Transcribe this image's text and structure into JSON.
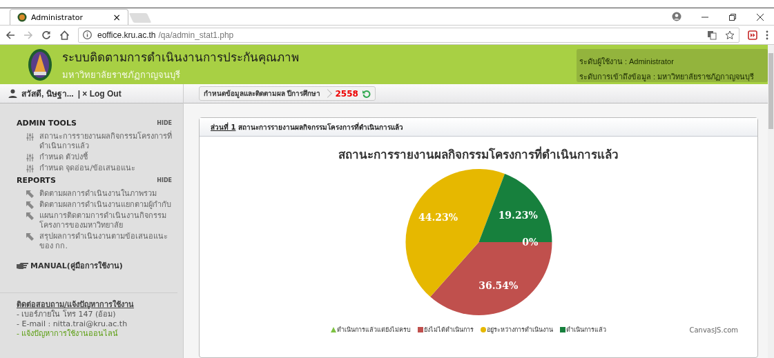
{
  "browser": {
    "tab_title": "Administrator",
    "tab_close": "×",
    "url_host": "eoffice.kru.ac.th",
    "url_path": "/qa/admin_stat1.php"
  },
  "header": {
    "title": "ระบบติดตามการดำเนินงานการประกันคุณภาพ",
    "subtitle": "มหาวิทยาลัยราชภัฏกาญจนบุรี",
    "user_level": "ระดับผู้ใช้งาน : Administrator",
    "access_level": "ระดับการเข้าถึงข้อมูล : มหาวิทยาลัยราชภัฏกาญจนบุรี"
  },
  "user_bar": {
    "greeting": "สวัสดี, นิษฐา...",
    "logout": "| × Log Out"
  },
  "breadcrumb": {
    "label": "กำหนดข้อมูลและติดตามผล ปีการศึกษา",
    "year": "2558"
  },
  "sidebar": {
    "sections": [
      {
        "title": "ADMIN TOOLS",
        "hide": "HIDE",
        "kind": "tools",
        "items": [
          "สถานะการรายงานผลกิจกรรมโครงการที่ดำเนินการแล้ว",
          "กำหนด ตัวบ่งชี้",
          "กำหนด จุดอ่อน/ข้อเสนอแนะ"
        ]
      },
      {
        "title": "REPORTS",
        "hide": "HIDE",
        "kind": "reports",
        "items": [
          "ติดตามผลการดำเนินงานในภาพรวม",
          "ติดตามผลการดำเนินงานแยกตามผู้กำกับ",
          "แผนการติดตามการดำเนินงานกิจกรรมโครงการของมหาวิทยาลัย",
          "สรุปผลการดำเนินงานตามข้อเสนอแนะของ กก."
        ]
      }
    ],
    "manual": "MANUAL(คู่มือการใช้งาน)",
    "contact": {
      "title": "ติดต่อสอบถาม/แจ้งปัญหาการใช้งาน",
      "phone": "- เบอร์ภายใน โทร 147 (อ้อม)",
      "email": "- E-mail : nitta.trai@kru.ac.th",
      "report_link": "- แจ้งปัญหาการใช้งานออนไลน์"
    }
  },
  "panel": {
    "part": "ส่วนที่ 1",
    "title": "สถานะการรายงานผลกิจกรรมโครงการที่ดำเนินการแล้ว",
    "chart_data": {
      "type": "pie",
      "title": "สถานะการรายงานผลกิจกรรมโครงการที่ดำเนินการแล้ว",
      "categories": [
        "ดำเนินการแล้วแต่ยังไม่ครบ",
        "ยังไม่ได้ดำเนินการ",
        "อยู่ระหว่างการดำเนินงาน",
        "ดำเนินการแล้ว"
      ],
      "values": [
        0,
        36.54,
        44.23,
        19.23
      ],
      "value_labels": [
        "0%",
        "36.54%",
        "44.23%",
        "19.23%"
      ],
      "legend": [
        {
          "kind": "triangle",
          "color": "#7dc242"
        },
        {
          "kind": "square",
          "color": "#c0504d"
        },
        {
          "kind": "circle",
          "color": "#e6b800"
        },
        {
          "kind": "square",
          "color": "#17803d"
        }
      ]
    },
    "credit": "CanvasJS.com"
  }
}
